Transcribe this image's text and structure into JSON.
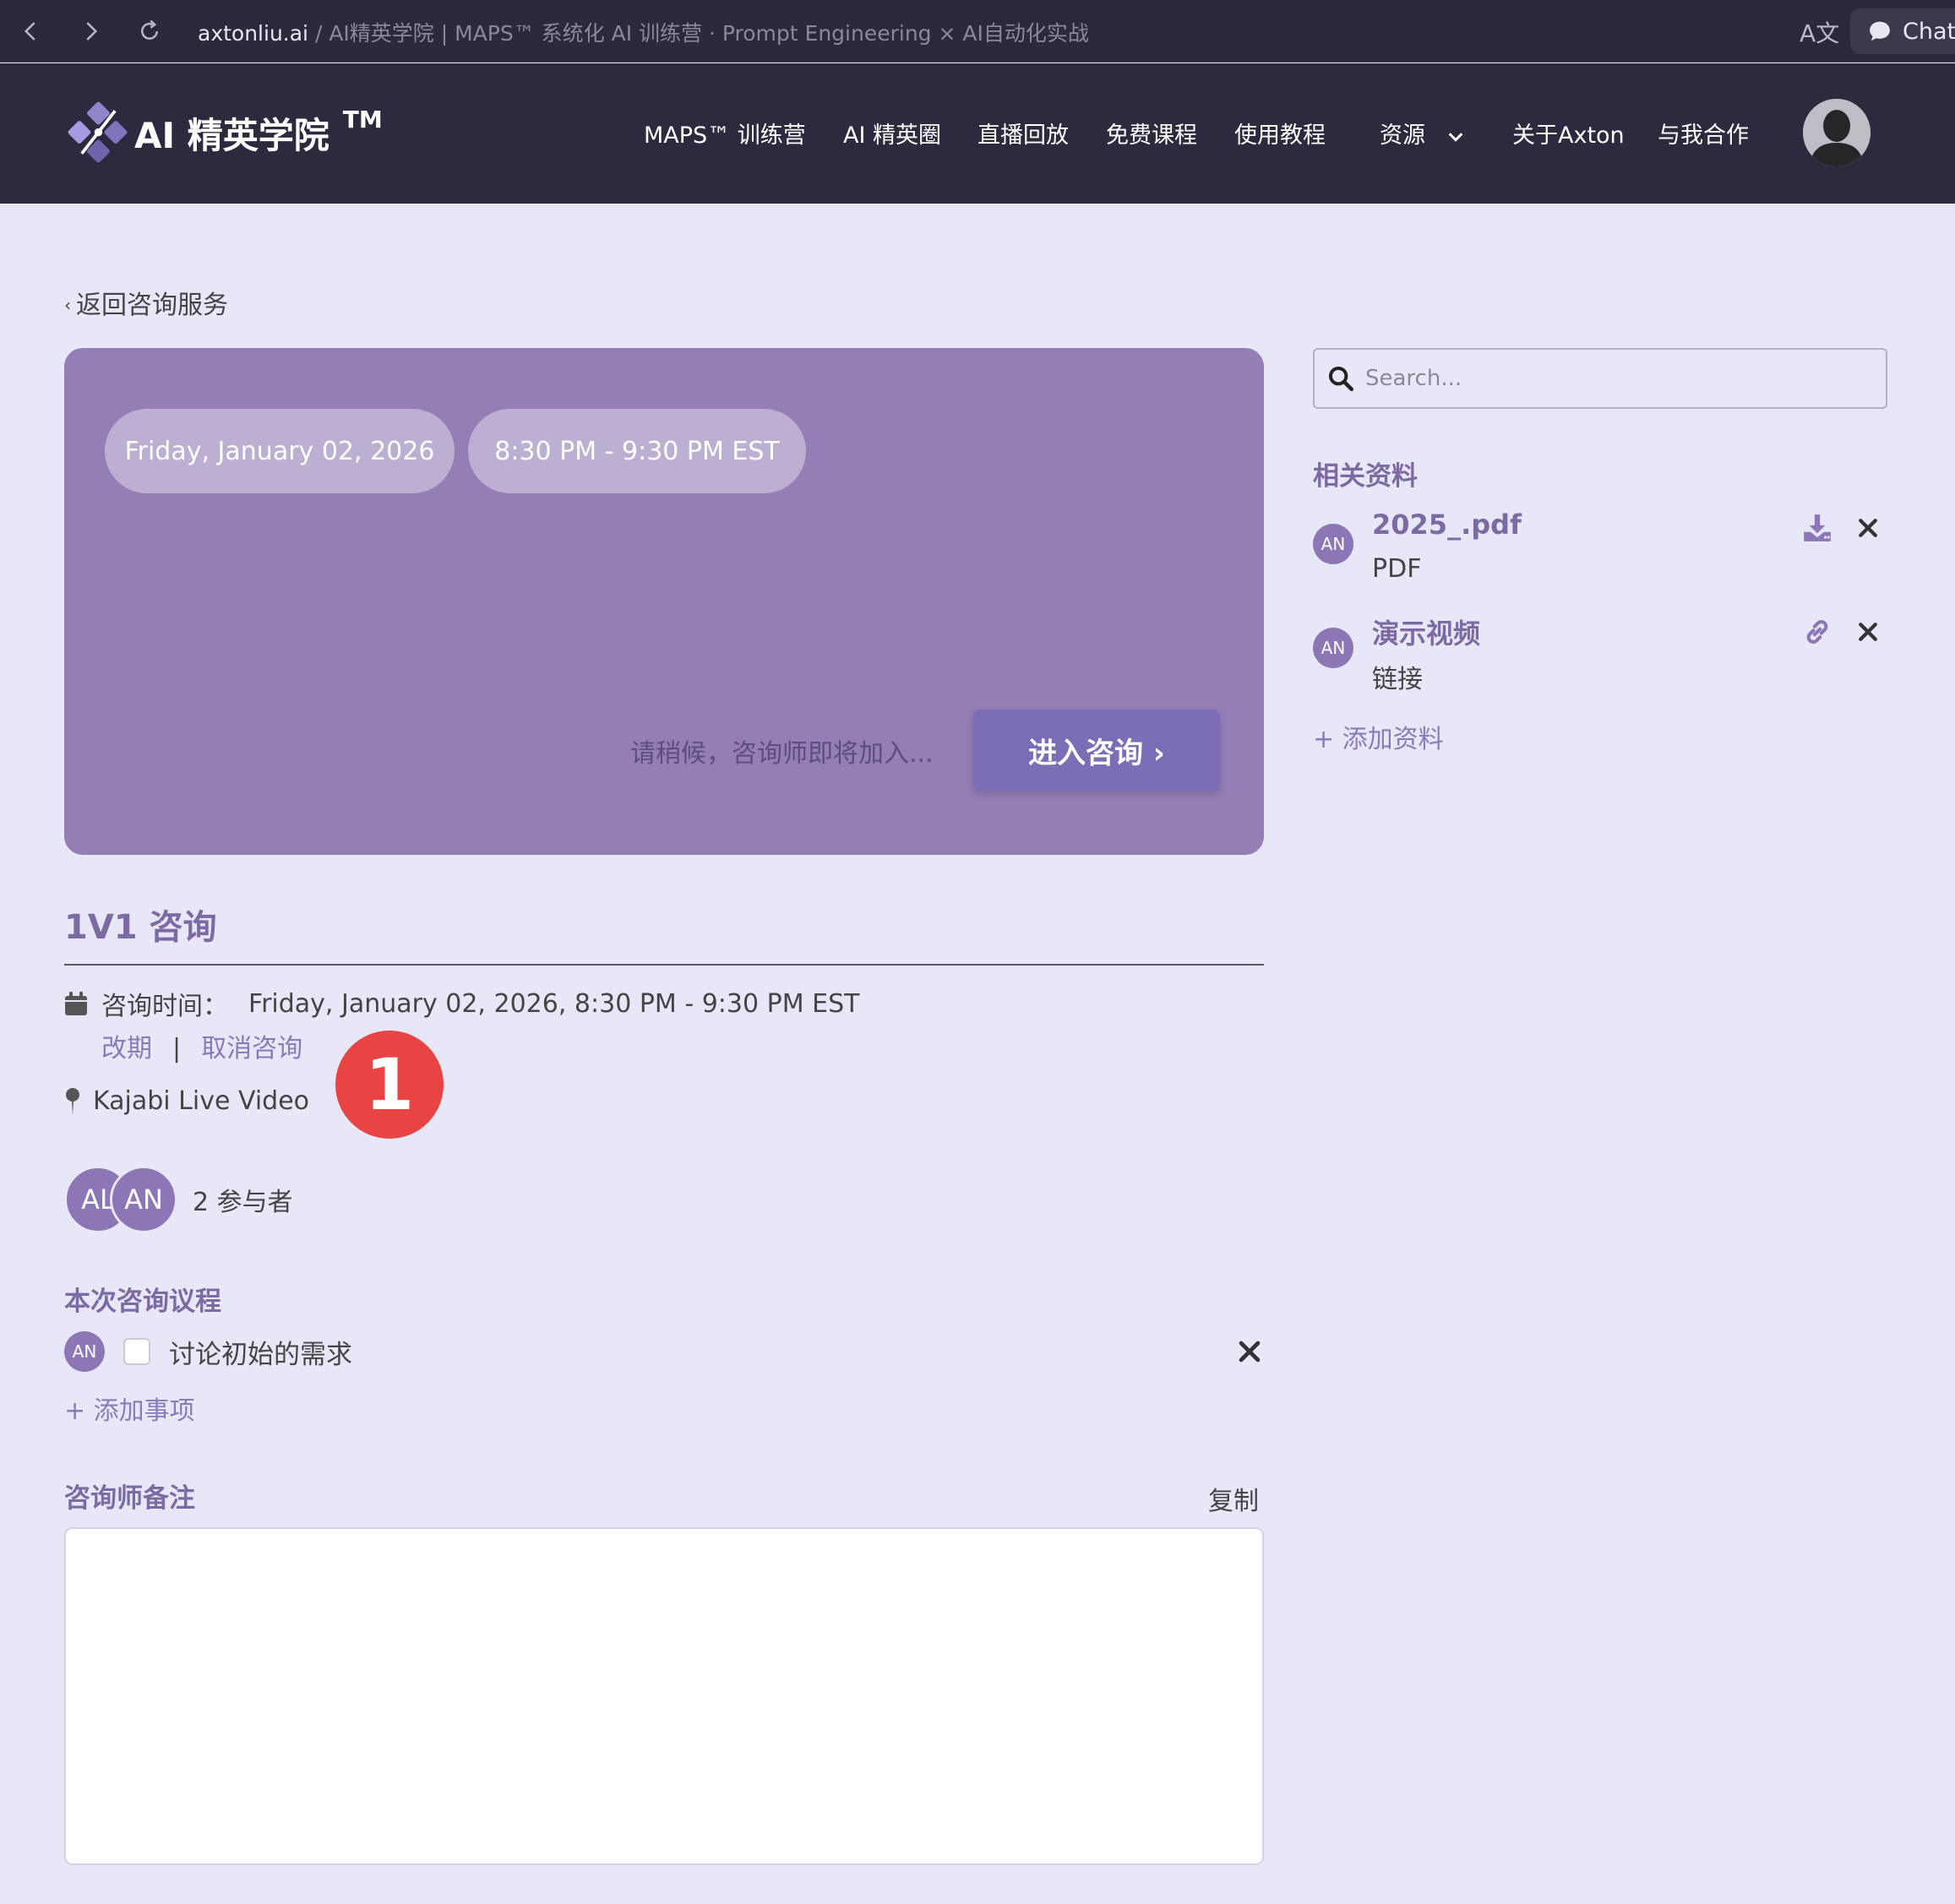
{
  "browser": {
    "domain": "axtonliu.ai",
    "title": " / AI精英学院 | MAPS™ 系统化 AI 训练营 · Prompt Engineering × AI自动化实战",
    "chat_label": "Chat",
    "translate_glyph": "A文"
  },
  "header": {
    "logo_text": "AI 精英学院",
    "logo_tm": "TM",
    "nav": [
      "MAPS™ 训练营",
      "AI 精英圈",
      "直播回放",
      "免费课程",
      "使用教程",
      "资源",
      "关于Axton",
      "与我合作"
    ]
  },
  "back_link": "返回咨询服务",
  "session": {
    "date_pill": "Friday, January 02, 2026",
    "time_pill": "8:30 PM - 9:30 PM EST",
    "waiting_text": "请稍候，咨询师即将加入...",
    "enter_button": "进入咨询 ›",
    "title": "1V1 咨询",
    "time_label": "咨询时间：",
    "time_value": "Friday, January 02, 2026, 8:30 PM - 9:30 PM EST",
    "reschedule": "改期",
    "separator": "|",
    "cancel": "取消咨询",
    "location": "Kajabi Live Video",
    "badge": "1"
  },
  "participants": {
    "avatars": [
      "AL",
      "AN"
    ],
    "count_text": "2  参与者"
  },
  "agenda": {
    "title": "本次咨询议程",
    "items": [
      {
        "avatar": "AN",
        "text": "讨论初始的需求"
      }
    ],
    "add_label": "+ 添加事项"
  },
  "notes": {
    "title": "咨询师备注",
    "copy_label": "复制"
  },
  "sidebar": {
    "search_placeholder": "Search...",
    "resources_title": "相关资料",
    "resources": [
      {
        "avatar": "AN",
        "name": "2025_.pdf",
        "type": "PDF",
        "action_icon": "download-icon"
      },
      {
        "avatar": "AN",
        "name": "演示视频",
        "type": "链接",
        "action_icon": "link-icon"
      }
    ],
    "add_resource": "+ 添加资料"
  },
  "colors": {
    "accent": "#7c6aa3",
    "hero_bg": "#937fb6",
    "header_bg": "#2b2a3f",
    "page_bg": "#e8e7f8",
    "badge": "#e94444"
  }
}
